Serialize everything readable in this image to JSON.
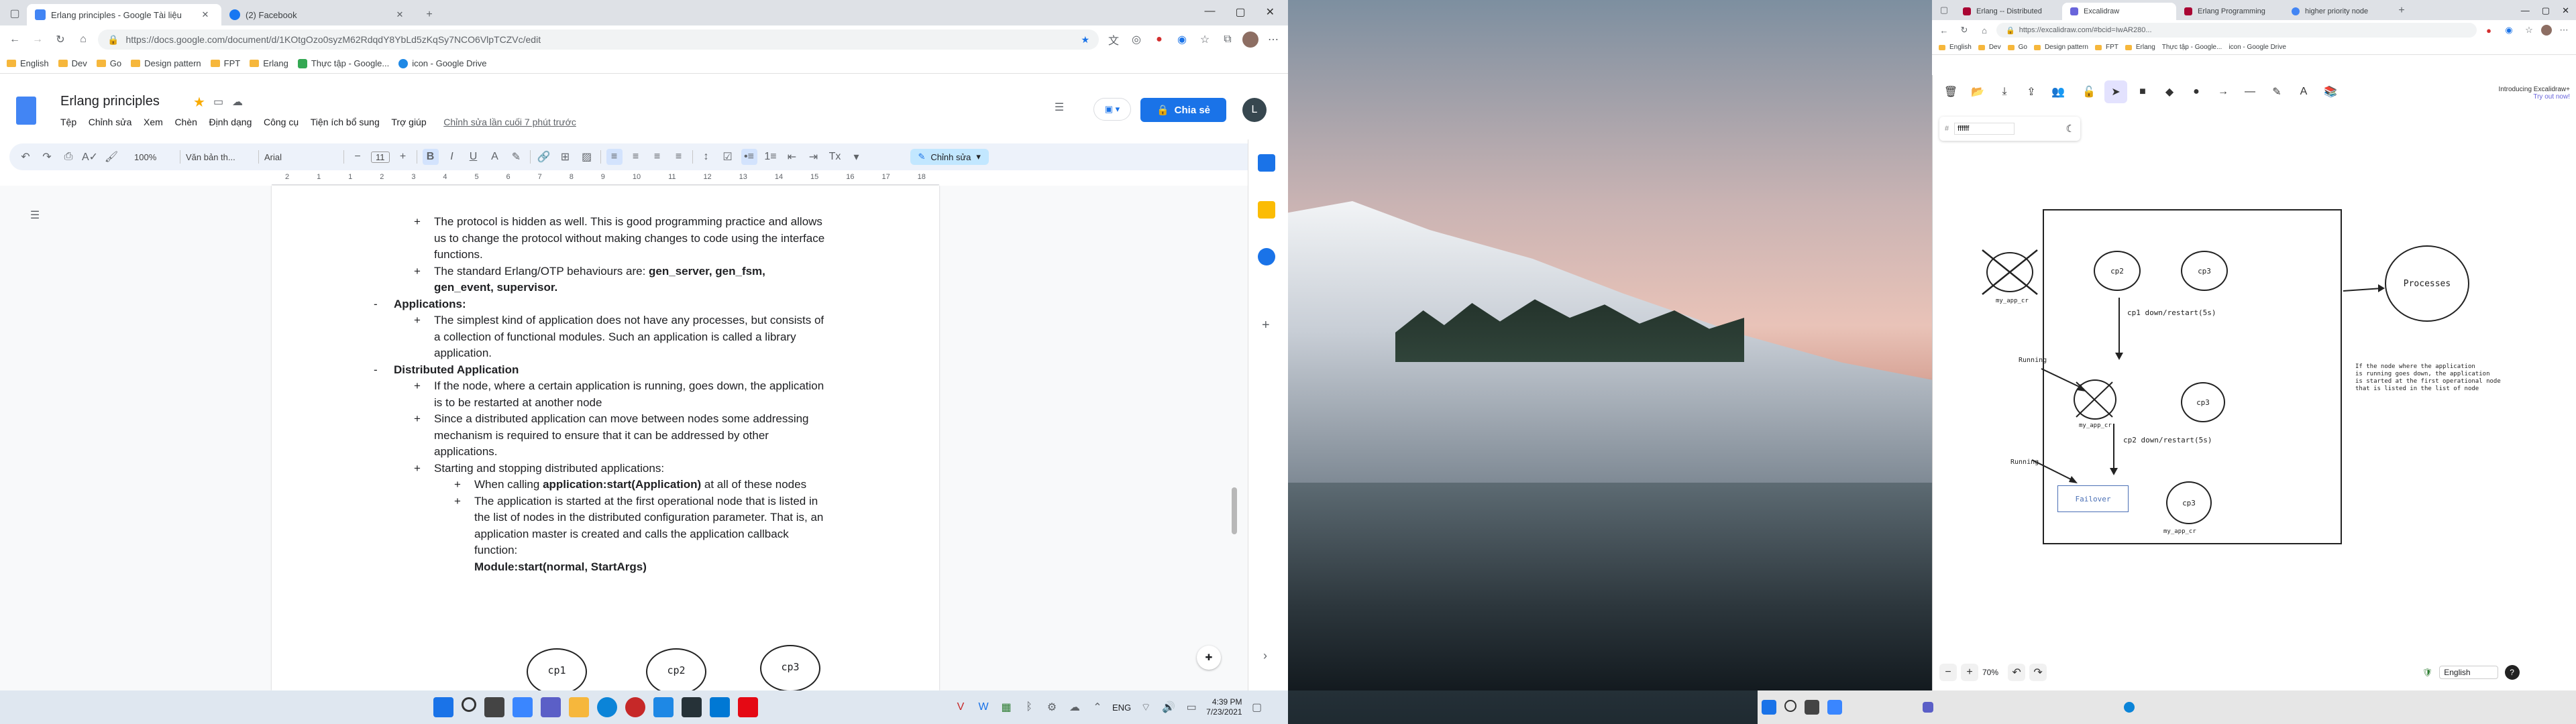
{
  "docs_window": {
    "tabs": [
      {
        "label": "Erlang principles - Google Tài liệu",
        "active": true
      },
      {
        "label": "(2) Facebook",
        "active": false
      }
    ],
    "url": "https://docs.google.com/document/d/1KOtgOzo0syzM62RdqdY8YbLd5zKqSy7NCO6VlpTCZVc/edit",
    "bookmarks": [
      "English",
      "Dev",
      "Go",
      "Design pattern",
      "FPT",
      "Erlang",
      "Thực tập - Google...",
      "icon - Google Drive"
    ],
    "doc_title": "Erlang principles",
    "menu": [
      "Tệp",
      "Chỉnh sửa",
      "Xem",
      "Chèn",
      "Định dạng",
      "Công cụ",
      "Tiện ích bổ sung",
      "Trợ giúp"
    ],
    "last_edit": "Chỉnh sửa lần cuối 7 phút trước",
    "share_label": "Chia sẻ",
    "avatar_letter": "L",
    "toolbar": {
      "zoom": "100%",
      "style": "Văn bản th...",
      "font": "Arial",
      "size": "11",
      "mode": "Chỉnh sửa"
    },
    "ruler_numbers": [
      "2",
      "1",
      "1",
      "2",
      "3",
      "4",
      "5",
      "6",
      "7",
      "8",
      "9",
      "10",
      "11",
      "12",
      "13",
      "14",
      "15",
      "16",
      "17",
      "18"
    ],
    "doc_lines": [
      {
        "bullet": "+",
        "text": "The protocol is hidden as well. This is good programming practice and allows",
        "bold_tail": ""
      },
      {
        "bullet": "",
        "text": "us to change the protocol without making changes to code using the interface",
        "bold_tail": ""
      },
      {
        "bullet": "",
        "text": "functions.",
        "bold_tail": ""
      },
      {
        "bullet": "+",
        "text": "The standard Erlang/OTP behaviours are: ",
        "bold_tail": "gen_server, gen_fsm,"
      },
      {
        "bullet": "",
        "text": "",
        "bold_tail": "gen_event, supervisor."
      },
      {
        "bullet": "-",
        "text": "",
        "bold_tail": "Applications:"
      },
      {
        "bullet": "+",
        "text": "The simplest kind of application does not have any processes, but consists of",
        "bold_tail": ""
      },
      {
        "bullet": "",
        "text": "a collection of functional modules. Such an application is called a library",
        "bold_tail": ""
      },
      {
        "bullet": "",
        "text": "application.",
        "bold_tail": ""
      },
      {
        "bullet": "-",
        "text": "",
        "bold_tail": "Distributed Application"
      },
      {
        "bullet": "+",
        "text": "If the node, where a certain application is running, goes down, the application",
        "bold_tail": ""
      },
      {
        "bullet": "",
        "text": "is to be restarted at another node",
        "bold_tail": ""
      },
      {
        "bullet": "+",
        "text": "Since a distributed application can move between nodes some addressing",
        "bold_tail": ""
      },
      {
        "bullet": "",
        "text": "mechanism is required to ensure that it can be addressed by other",
        "bold_tail": ""
      },
      {
        "bullet": "",
        "text": "applications.",
        "bold_tail": ""
      },
      {
        "bullet": "+",
        "text": "Starting and stopping distributed applications:",
        "bold_tail": ""
      },
      {
        "bullet": "+",
        "text": "When calling ",
        "bold_tail": "application:start(Application)",
        "tail": " at all of these nodes"
      },
      {
        "bullet": "+",
        "text": "The application is started at the first operational node that is listed in",
        "bold_tail": ""
      },
      {
        "bullet": "",
        "text": "the list of nodes in the distributed configuration parameter. That is, an",
        "bold_tail": ""
      },
      {
        "bullet": "",
        "text": "application master is created and calls the application callback",
        "bold_tail": ""
      },
      {
        "bullet": "",
        "text": "function:",
        "bold_tail": ""
      },
      {
        "bullet": "",
        "text": "",
        "bold_tail": "Module:start(normal, StartArgs)"
      }
    ],
    "doc_nodes": [
      "cp1",
      "cp2",
      "cp3"
    ]
  },
  "excalidraw_window": {
    "tabs": [
      {
        "label": "Erlang -- Distributed",
        "active": false
      },
      {
        "label": "Excalidraw",
        "active": true
      },
      {
        "label": "Erlang Programming",
        "active": false
      },
      {
        "label": "higher priority node",
        "active": false
      }
    ],
    "url": "https://excalidraw.com/#bcid=IwAR280...",
    "bookmarks": [
      "English",
      "Dev",
      "Go",
      "Design pattern",
      "FPT",
      "Erlang",
      "Thực tập - Google...",
      "icon - Google Drive"
    ],
    "hex_color": "ffffff",
    "intro_line1": "Introducing Excalidraw+",
    "intro_line2": "Try out now!",
    "diagram": {
      "top_nodes": [
        "cp2",
        "cp3"
      ],
      "node_label": "my_app_cr",
      "mid_node": "cp2",
      "mid_node_right": "cp3",
      "bottom_node": "cp3",
      "edge1": "cp1 down/restart(5s)",
      "edge2": "cp2 down/restart(5s)",
      "running1": "Running",
      "running2": "Running",
      "failover": "Failover",
      "processes": "Processes",
      "note": [
        "If the node where the application",
        "is running goes down, the application",
        "is started at the first operational node",
        "that is listed in the list of node"
      ]
    },
    "zoom": "70%",
    "language": "English"
  },
  "taskbar": {
    "lang": "ENG",
    "time": "4:39 PM",
    "date": "7/23/2021"
  }
}
